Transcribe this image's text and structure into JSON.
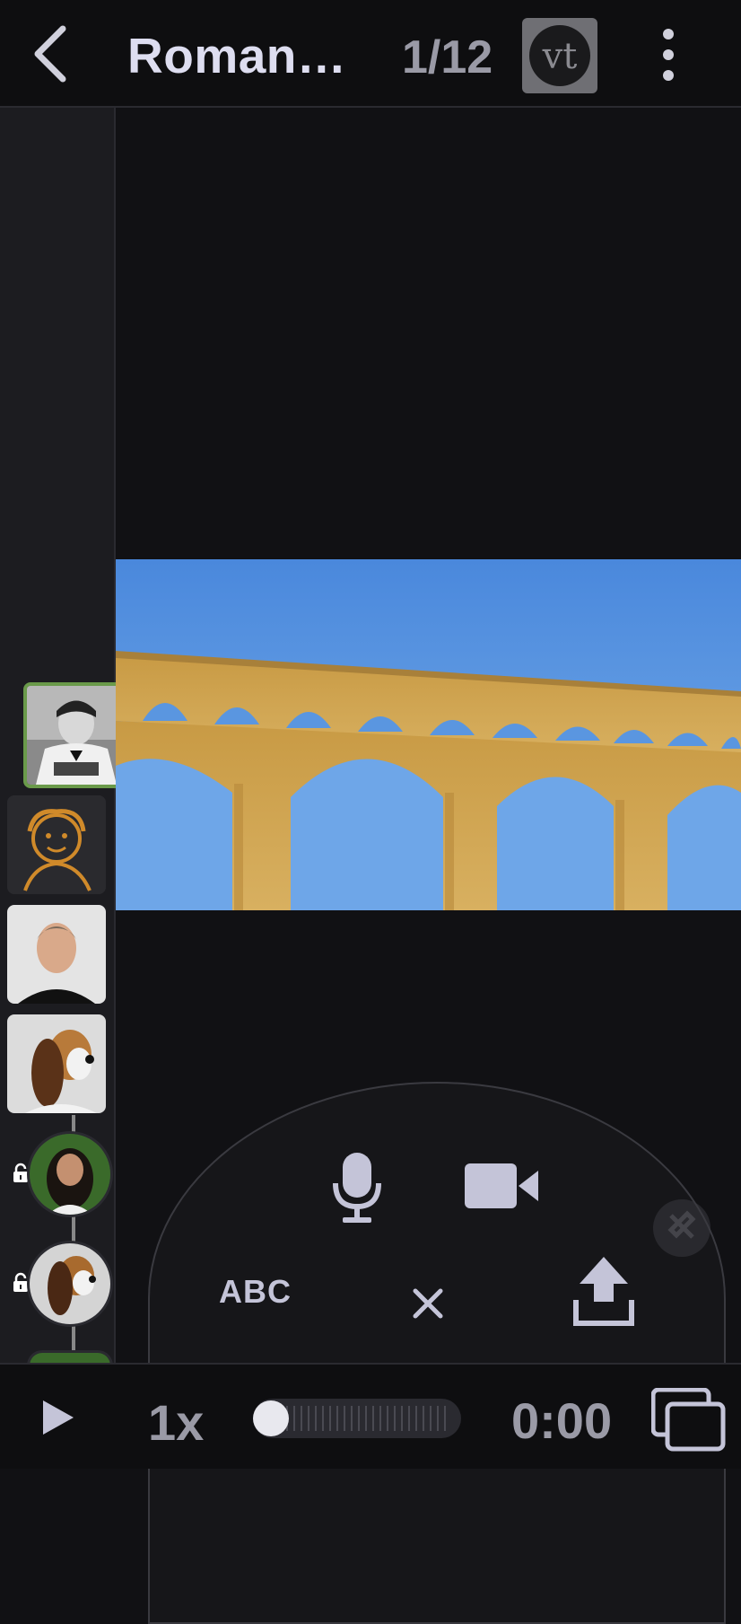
{
  "header": {
    "title": "Roman…",
    "counter": "1/12",
    "logo_text": "vt"
  },
  "sidebar": {
    "thumbnails": [
      {
        "name": "man-in-tuxedo",
        "active": true
      },
      {
        "name": "doodle-avatar",
        "active": false
      },
      {
        "name": "man-portrait",
        "active": false
      },
      {
        "name": "basset-hound",
        "active": false
      }
    ],
    "locked_commenters": [
      {
        "name": "woman-avatar",
        "locked": true
      },
      {
        "name": "basset-hound-avatar",
        "locked": true
      }
    ]
  },
  "stage": {
    "image_subject": "aqueduct-photo"
  },
  "controls": {
    "text_label": "ABC",
    "close_label": "×"
  },
  "playback": {
    "speed": "1x",
    "time": "0:00",
    "progress": 0.0
  },
  "colors": {
    "accent": "#6a9a4a",
    "sky": "#5b95e0",
    "stone": "#d4a94a"
  }
}
